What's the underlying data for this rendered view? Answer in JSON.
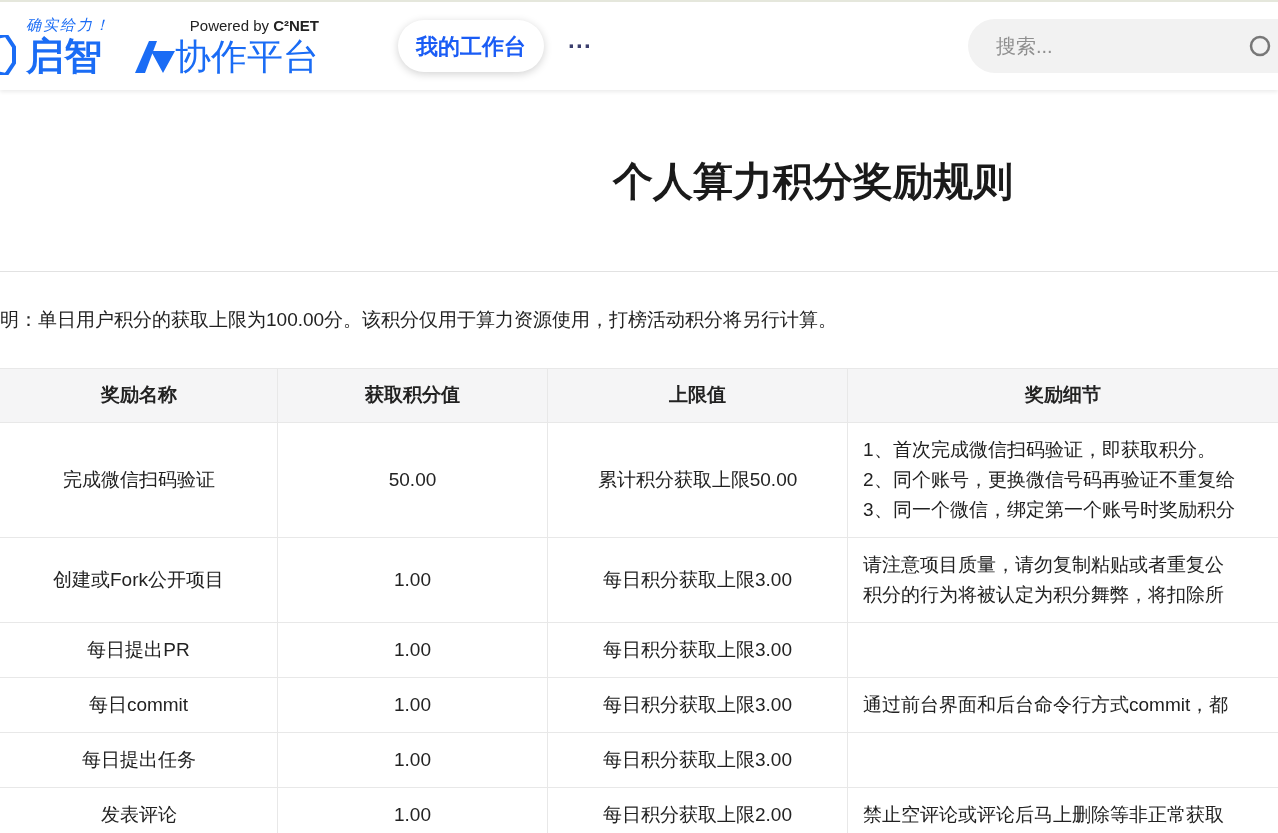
{
  "header": {
    "slogan": "确实给力！",
    "brand": "启智",
    "powered": "Powered by **C²NET**",
    "platform": "协作平台",
    "nav_button": "我的工作台",
    "more": "···",
    "search": {
      "placeholder": "搜索..."
    }
  },
  "title": "个人算力积分奖励规则",
  "notice": "明：单日用户积分的获取上限为100.00分。该积分仅用于算力资源使用，打榜活动积分将另行计算。",
  "table": {
    "columns": [
      "奖励名称",
      "获取积分值",
      "上限值",
      "奖励细节"
    ],
    "rows": [
      {
        "name": "完成微信扫码验证",
        "points": "50.00",
        "limit": "累计积分获取上限50.00",
        "details": [
          "1、首次完成微信扫码验证，即获取积分。",
          "2、同个账号，更换微信号码再验证不重复给",
          "3、同一个微信，绑定第一个账号时奖励积分"
        ]
      },
      {
        "name": "创建或Fork公开项目",
        "points": "1.00",
        "limit": "每日积分获取上限3.00",
        "details": [
          "请注意项目质量，请勿复制粘贴或者重复公",
          "积分的行为将被认定为积分舞弊，将扣除所"
        ]
      },
      {
        "name": "每日提出PR",
        "points": "1.00",
        "limit": "每日积分获取上限3.00",
        "details": []
      },
      {
        "name": "每日commit",
        "points": "1.00",
        "limit": "每日积分获取上限3.00",
        "details": [
          "通过前台界面和后台命令行方式commit，都"
        ]
      },
      {
        "name": "每日提出任务",
        "points": "1.00",
        "limit": "每日积分获取上限3.00",
        "details": []
      },
      {
        "name": "发表评论",
        "points": "1.00",
        "limit": "每日积分获取上限2.00",
        "details": [
          "禁止空评论或评论后马上删除等非正常获取"
        ]
      }
    ]
  }
}
